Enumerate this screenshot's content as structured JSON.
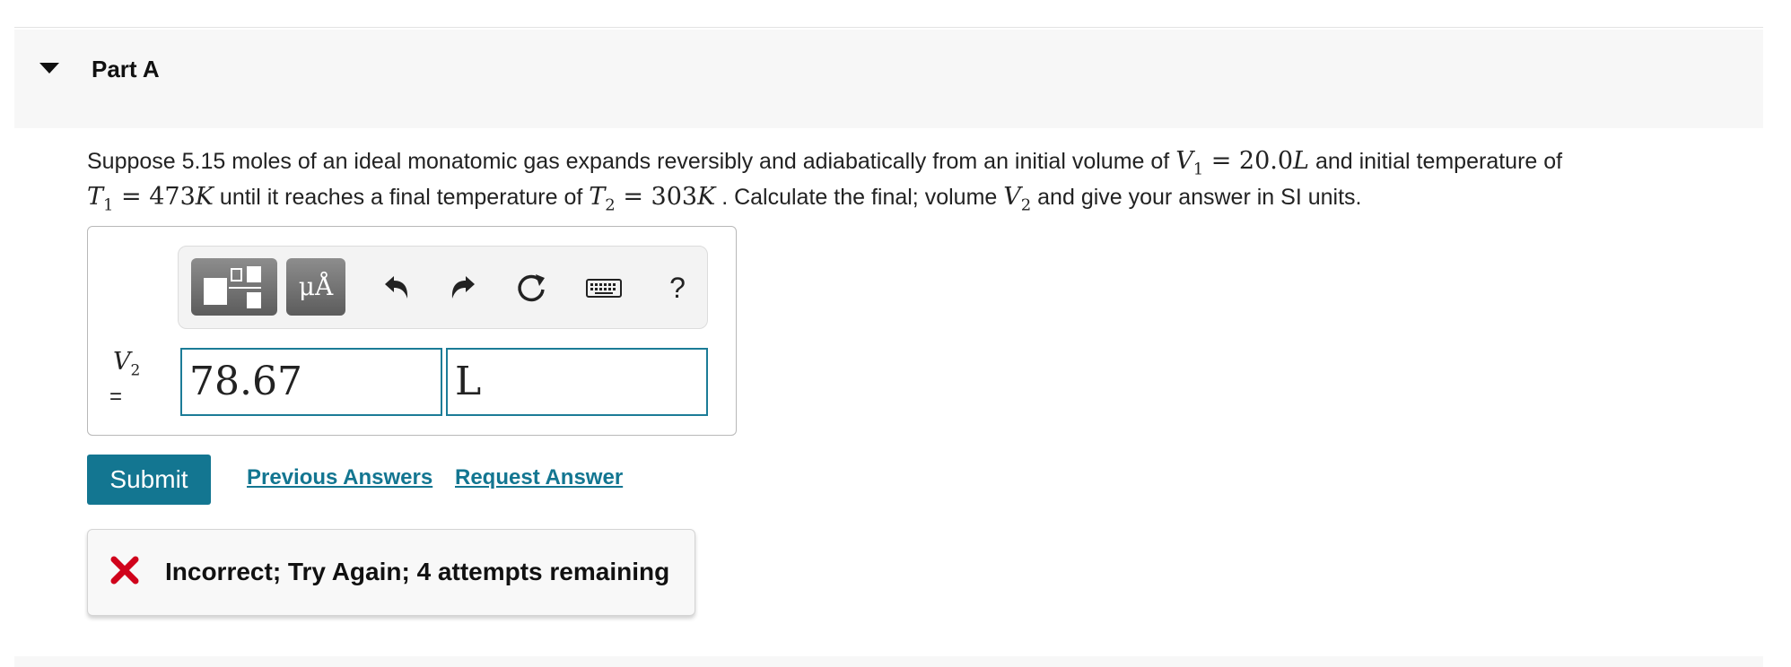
{
  "part": {
    "title": "Part A"
  },
  "question": {
    "text_1": "Suppose 5.15 moles of an ideal monatomic gas expands reversibly and adiabatically from an initial volume of",
    "v1_symbol": "V",
    "v1_sub": "1",
    "v1_value": " = 20.0",
    "v1_unit": "L",
    "text_2": "and initial temperature of",
    "t1_symbol": "T",
    "t1_sub": "1",
    "t1_value": " = 473",
    "t1_unit": "K",
    "text_3": "until it reaches a final temperature of",
    "t2_symbol": "T",
    "t2_sub": "2",
    "t2_value": " = 303",
    "t2_unit": "K",
    "text_4": ". Calculate the final; volume",
    "v2_symbol": "V",
    "v2_sub": "2",
    "text_5": "and give your answer in SI units."
  },
  "toolbar": {
    "units_label": "μÅ",
    "help_label": "?",
    "icons": [
      "templates-icon",
      "undo-icon",
      "redo-icon",
      "reset-icon",
      "keyboard-icon",
      "help-icon"
    ]
  },
  "answer": {
    "symbol": "V",
    "symbol_sub": "2",
    "equals": "=",
    "value": "78.67",
    "unit": "L"
  },
  "actions": {
    "submit_label": "Submit",
    "previous_answers_label": "Previous Answers",
    "request_answer_label": "Request Answer"
  },
  "feedback": {
    "text": "Incorrect; Try Again; 4 attempts remaining",
    "status_color": "#d0021b"
  },
  "colors": {
    "accent": "#137691",
    "header_bg": "#f7f7f7"
  }
}
